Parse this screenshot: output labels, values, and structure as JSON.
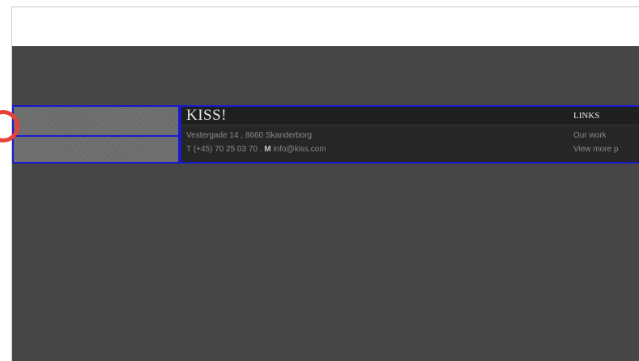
{
  "colors": {
    "accent_outline": "#1a1ad0",
    "marker": "#e8413a",
    "background_dark": "#464646",
    "footer_bg": "#262626"
  },
  "footer": {
    "brand": "KISS!",
    "address": "Vestergade 14 , 8660 Skanderborg",
    "contact": {
      "phone_label": "T",
      "phone": "(+45) 70 25 03 70",
      "separator": " . ",
      "mail_label": "M",
      "email": "info@kiss.com"
    },
    "links": {
      "heading": "LINKS",
      "items": [
        "Our work",
        "View more p"
      ]
    }
  },
  "marker": {
    "icon": "circle-highlight-icon"
  }
}
